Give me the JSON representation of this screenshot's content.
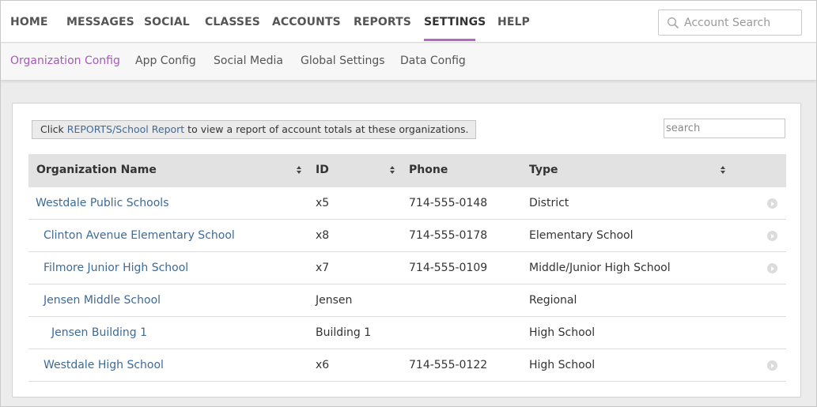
{
  "nav": {
    "items": [
      "HOME",
      "MESSAGES",
      "SOCIAL",
      "CLASSES",
      "ACCOUNTS",
      "REPORTS",
      "SETTINGS",
      "HELP"
    ],
    "active": "SETTINGS",
    "accent_color": "#b368c6",
    "account_search_placeholder": "Account Search"
  },
  "subnav": {
    "items": [
      "Organization Config",
      "App Config",
      "Social Media",
      "Global Settings",
      "Data Config"
    ],
    "active": "Organization Config"
  },
  "notice": {
    "prefix": "Click ",
    "link": "REPORTS/School Report",
    "suffix": " to view a report of account totals at these organizations."
  },
  "table": {
    "search_placeholder": "search",
    "headers": {
      "name": "Organization Name",
      "id": "ID",
      "phone": "Phone",
      "type": "Type"
    },
    "rows": [
      {
        "name": "Westdale Public Schools",
        "id": "x5",
        "phone": "714-555-0148",
        "type": "District",
        "level": 0,
        "action": true
      },
      {
        "name": "Clinton Avenue Elementary School",
        "id": "x8",
        "phone": "714-555-0178",
        "type": "Elementary School",
        "level": 1,
        "action": true
      },
      {
        "name": "Filmore Junior High School",
        "id": "x7",
        "phone": "714-555-0109",
        "type": "Middle/Junior High School",
        "level": 1,
        "action": true
      },
      {
        "name": "Jensen Middle School",
        "id": "Jensen",
        "phone": "",
        "type": "Regional",
        "level": 1,
        "action": false
      },
      {
        "name": "Jensen Building 1",
        "id": "Building 1",
        "phone": "",
        "type": "High School",
        "level": 2,
        "action": false
      },
      {
        "name": "Westdale High School",
        "id": "x6",
        "phone": "714-555-0122",
        "type": "High School",
        "level": 1,
        "action": true
      }
    ]
  }
}
